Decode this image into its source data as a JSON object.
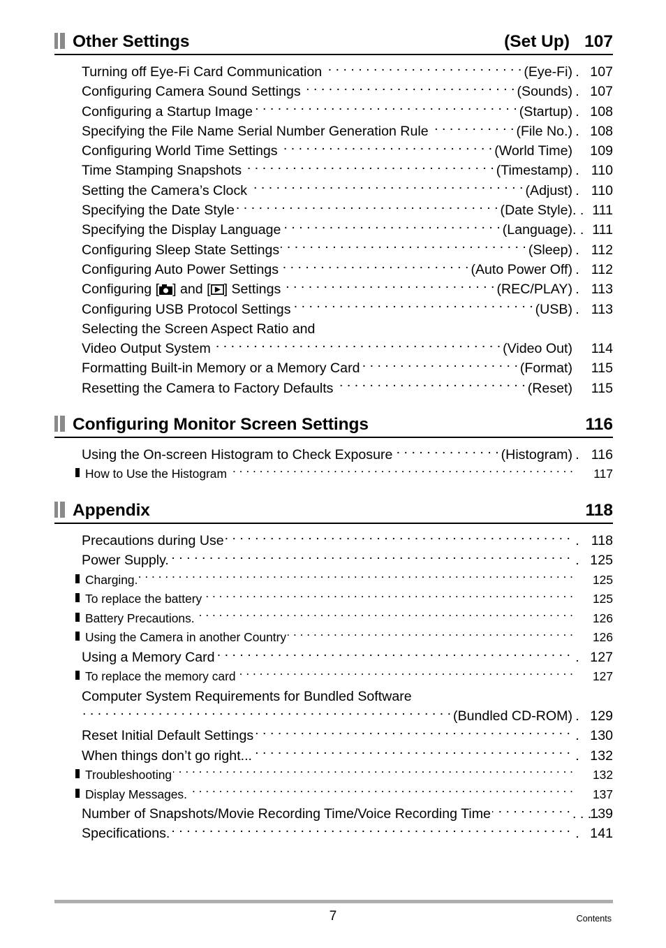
{
  "document": {
    "footer_page_number": "7",
    "footer_label": "Contents"
  },
  "sections": [
    {
      "title": "Other Settings",
      "tag": "(Set Up)",
      "page": "107",
      "entries": [
        {
          "label": "Turning off Eye-Fi Card Communication",
          "tag": "(Eye-Fi)",
          "dot": ".",
          "page": "107",
          "level": "main"
        },
        {
          "label": "Configuring Camera Sound Settings",
          "tag": "(Sounds)",
          "dot": ".",
          "page": "107",
          "level": "main"
        },
        {
          "label": "Configuring a Startup Image",
          "tag": "(Startup)",
          "dot": ".",
          "page": "108",
          "level": "main"
        },
        {
          "label": "Specifying the File Name Serial Number Generation Rule",
          "tag": "(File No.)",
          "dot": ".",
          "page": "108",
          "level": "main"
        },
        {
          "label": "Configuring World Time Settings",
          "tag": "(World Time)",
          "dot": "",
          "page": "109",
          "level": "main"
        },
        {
          "label": "Time Stamping Snapshots",
          "tag": "(Timestamp)",
          "dot": ".",
          "page": "110",
          "level": "main"
        },
        {
          "label": "Setting the Camera’s Clock",
          "tag": "(Adjust)",
          "dot": ".",
          "page": "110",
          "level": "main"
        },
        {
          "label": "Specifying the Date Style",
          "tag": "(Date Style)",
          "dot": ". .",
          "page": "111",
          "level": "main"
        },
        {
          "label": "Specifying the Display Language",
          "tag": "(Language)",
          "dot": ". .",
          "page": "111",
          "level": "main"
        },
        {
          "label": "Configuring Sleep State Settings",
          "tag": "(Sleep)",
          "dot": ".",
          "page": "112",
          "level": "main"
        },
        {
          "label": "Configuring Auto Power Settings",
          "tag": "(Auto Power Off)",
          "dot": ".",
          "page": "112",
          "level": "main"
        },
        {
          "label": "Configuring [",
          "label_mid": "] and [",
          "label_end": "] Settings",
          "icons": [
            "camera-icon",
            "play-icon"
          ],
          "tag": "(REC/PLAY)",
          "dot": ".",
          "page": "113",
          "level": "main"
        },
        {
          "label": "Configuring USB Protocol Settings",
          "tag": "(USB)",
          "dot": ".",
          "page": "113",
          "level": "main"
        },
        {
          "label": "Selecting the Screen Aspect Ratio and",
          "tag": "",
          "dot": "",
          "page": "",
          "level": "main",
          "continuation": true
        },
        {
          "label": "Video Output System",
          "tag": "(Video Out)",
          "dot": "",
          "page": "114",
          "level": "main"
        },
        {
          "label": "Formatting Built-in Memory or a Memory Card",
          "tag": "(Format)",
          "dot": "",
          "page": "115",
          "level": "main"
        },
        {
          "label": "Resetting the Camera to Factory Defaults",
          "tag": "(Reset)",
          "dot": "",
          "page": "115",
          "level": "main"
        }
      ]
    },
    {
      "title": "Configuring Monitor Screen Settings",
      "tag": "",
      "page": "116",
      "entries": [
        {
          "label": "Using the On-screen Histogram to Check Exposure",
          "tag": "(Histogram)",
          "dot": ".",
          "page": "116",
          "level": "main"
        },
        {
          "label": "How to Use the Histogram",
          "tag": "",
          "dot": "",
          "page": "117",
          "level": "sub"
        }
      ]
    },
    {
      "title": "Appendix",
      "tag": "",
      "page": "118",
      "entries": [
        {
          "label": "Precautions during Use",
          "tag": "",
          "dot": ".",
          "page": "118",
          "level": "main"
        },
        {
          "label": "Power Supply.",
          "tag": "",
          "dot": ".",
          "page": "125",
          "level": "main"
        },
        {
          "label": "Charging.",
          "tag": "",
          "dot": "",
          "page": "125",
          "level": "sub"
        },
        {
          "label": "To replace the battery",
          "tag": "",
          "dot": "",
          "page": "125",
          "level": "sub"
        },
        {
          "label": "Battery Precautions.",
          "tag": "",
          "dot": "",
          "page": "126",
          "level": "sub"
        },
        {
          "label": "Using the Camera in another Country",
          "tag": "",
          "dot": "",
          "page": "126",
          "level": "sub"
        },
        {
          "label": "Using a Memory Card",
          "tag": "",
          "dot": ".",
          "page": "127",
          "level": "main"
        },
        {
          "label": "To replace the memory card",
          "tag": "",
          "dot": "",
          "page": "127",
          "level": "sub"
        },
        {
          "label": "Computer System Requirements for Bundled Software",
          "tag": "",
          "dot": "",
          "page": "",
          "level": "main",
          "continuation": true
        },
        {
          "label": "",
          "tag": "(Bundled CD-ROM)",
          "dot": ".",
          "page": "129",
          "level": "main"
        },
        {
          "label": "Reset Initial Default Settings",
          "tag": "",
          "dot": ".",
          "page": "130",
          "level": "main"
        },
        {
          "label": "When things don’t go right...",
          "tag": "",
          "dot": ".",
          "page": "132",
          "level": "main"
        },
        {
          "label": "Troubleshooting",
          "tag": "",
          "dot": "",
          "page": "132",
          "level": "sub"
        },
        {
          "label": "Display Messages.",
          "tag": "",
          "dot": "",
          "page": "137",
          "level": "sub"
        },
        {
          "label": "Number of Snapshots/Movie Recording Time/Voice Recording Time",
          "tag": "",
          "dot": ". . . .",
          "page": "139",
          "level": "main"
        },
        {
          "label": "Specifications.",
          "tag": "",
          "dot": ".",
          "page": "141",
          "level": "main"
        }
      ]
    }
  ]
}
